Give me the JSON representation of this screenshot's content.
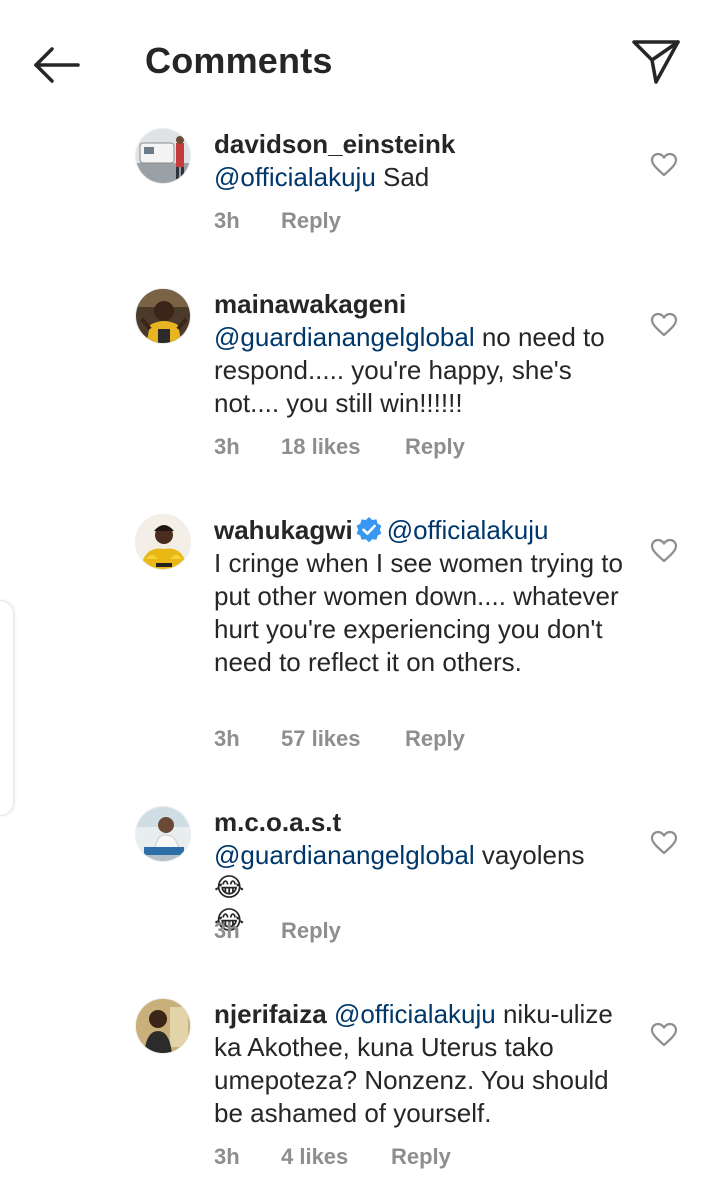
{
  "header": {
    "title": "Comments",
    "back_icon": "arrow-left-icon",
    "share_icon": "paper-plane-icon"
  },
  "colors": {
    "text": "#262626",
    "mention": "#00376b",
    "meta": "#8e8e8e",
    "verified": "#3897f0"
  },
  "comments": [
    {
      "username": "davidson_einsteink",
      "mention": "@officialakuju",
      "text": " Sad",
      "time": "3h",
      "likes": "",
      "reply": "Reply"
    },
    {
      "username": "mainawakageni",
      "mention": "@guardianangelglobal",
      "text": " no need to respond..... you're happy, she's not.... you still win!!!!!!",
      "time": "3h",
      "likes": "18 likes",
      "reply": "Reply"
    },
    {
      "username": "wahukagwi",
      "verified": true,
      "mention": "@officialakuju",
      "text": "I cringe when I see women trying to put other women down.... whatever hurt you're experiencing you don't need to reflect it on others.",
      "time": "3h",
      "likes": "57 likes",
      "reply": "Reply"
    },
    {
      "username": "m.c.o.a.s.t",
      "mention": "@guardianangelglobal",
      "text": " vayolens",
      "emoji": "😂😂",
      "time": "3h",
      "likes": "",
      "reply": "Reply"
    },
    {
      "username": "njerifaiza",
      "mention": "@officialakuju",
      "text": " niku-ulize ka Akothee, kuna Uterus tako umepoteza? Nonzenz. You should be ashamed of yourself.",
      "time": "3h",
      "likes": "4 likes",
      "reply": "Reply"
    }
  ]
}
